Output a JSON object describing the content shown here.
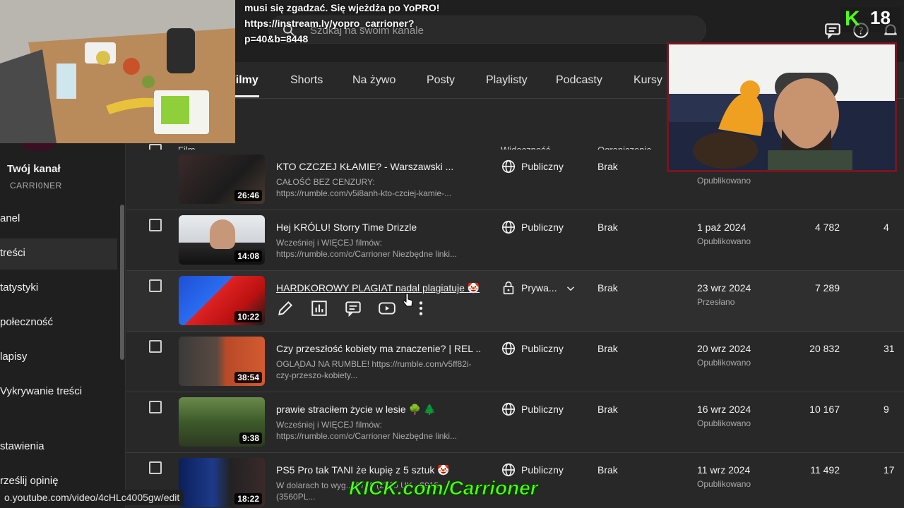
{
  "header": {
    "search_placeholder": "Szukaj na swoim kanale"
  },
  "tabs": [
    {
      "label": "Filmy",
      "active": true
    },
    {
      "label": "Shorts"
    },
    {
      "label": "Na żywo"
    },
    {
      "label": "Posty"
    },
    {
      "label": "Playlisty"
    },
    {
      "label": "Podcasty"
    },
    {
      "label": "Kursy"
    }
  ],
  "sidebar": {
    "channel_label": "Twój kanał",
    "channel_name": "CARRI0NER",
    "items": [
      {
        "label": "anel"
      },
      {
        "label": "treści",
        "active": true
      },
      {
        "label": "tatystyki"
      },
      {
        "label": "połeczność"
      },
      {
        "label": "lapisy"
      },
      {
        "label": "Vykrywanie treści"
      },
      {
        "label": "stawienia"
      },
      {
        "label": "rześlij opinię"
      }
    ]
  },
  "table": {
    "headers": {
      "film": "Film",
      "visibility": "Widoczność",
      "restrictions": "Ograniczenia"
    },
    "rows": [
      {
        "title": "KTO CZCZEJ KŁAMIE? - Warszawski ...",
        "desc": "CAŁOŚĆ BEZ CENZURY: https://rumble.com/v5i8anh-kto-czciej-kamie-...",
        "duration": "26:46",
        "visibility": "Publiczny",
        "restrictions": "Brak",
        "date": "",
        "status": "Opublikowano",
        "views": "",
        "extra": ""
      },
      {
        "title": "Hej KRÓLU! Storry Time Drizzle",
        "desc": "Wcześniej i WIĘCEJ filmów: https://rumble.com/c/Carrioner Niezbędne linki...",
        "duration": "14:08",
        "visibility": "Publiczny",
        "restrictions": "Brak",
        "date": "1 paź 2024",
        "status": "Opublikowano",
        "views": "4 782",
        "extra": "4"
      },
      {
        "title": "HARDKOROWY PLAGIAT nadal plagiatuje 🤡",
        "desc": "",
        "duration": "10:22",
        "visibility": "Prywa...",
        "restrictions": "Brak",
        "date": "23 wrz 2024",
        "status": "Przesłano",
        "views": "7 289",
        "extra": ""
      },
      {
        "title": "Czy przeszłość kobiety ma znaczenie? | REL ...",
        "desc": "OGLĄDAJ NA RUMBLE! https://rumble.com/v5ff82i-czy-przeszo-kobiety...",
        "duration": "38:54",
        "visibility": "Publiczny",
        "restrictions": "Brak",
        "date": "20 wrz 2024",
        "status": "Opublikowano",
        "views": "20 832",
        "extra": "31"
      },
      {
        "title": "prawie straciłem życie w lesie 🌳 🌲",
        "desc": "Wcześniej i WIĘCEJ filmów: https://rumble.com/c/Carrioner Niezbędne linki...",
        "duration": "9:38",
        "visibility": "Publiczny",
        "restrictions": "Brak",
        "date": "16 wrz 2024",
        "status": "Opublikowano",
        "views": "10 167",
        "extra": "9"
      },
      {
        "title": "PS5 Pro tak TANI że kupię z 5 sztuk 🤡",
        "desc": "W dolarach to wyg... $700 (2720 UK - $915 (3560PL...",
        "duration": "18:22",
        "visibility": "Publiczny",
        "restrictions": "Brak",
        "date": "11 wrz 2024",
        "status": "Opublikowano",
        "views": "11 492",
        "extra": "17"
      }
    ]
  },
  "overlay": {
    "stream_text": "musi się zgadzać. Się wjeżdża po YoPRO! https://instream.ly/yopro_carrioner?p=40&b=8448",
    "kick_number": "18",
    "kick_letter": "K",
    "kick_banner": "KICK.com/Carrioner",
    "status_url": "o.youtube.com/video/4cHLc4005gw/edit"
  },
  "colors": {
    "kick_green": "#53fc18",
    "cam_border": "#7a1420"
  }
}
